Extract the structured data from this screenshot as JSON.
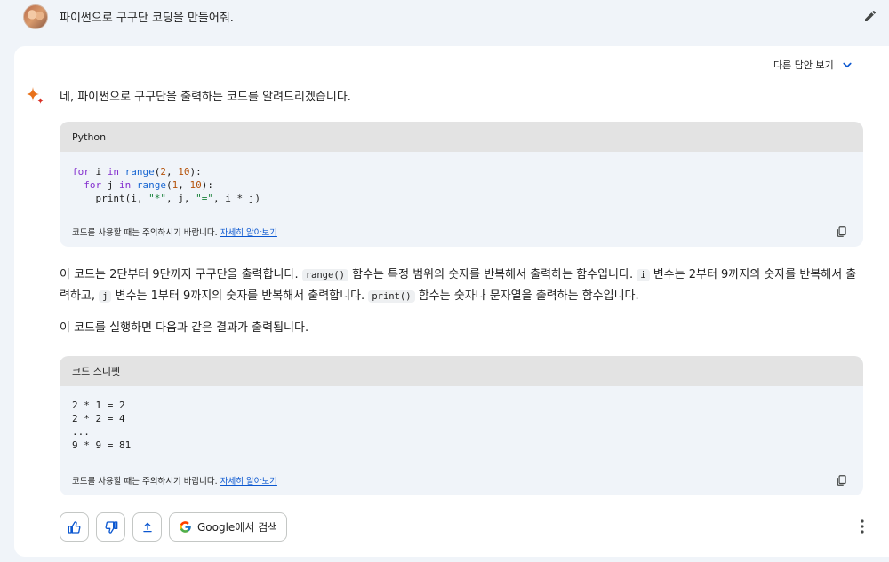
{
  "prompt": {
    "text": "파이썬으로 구구단 코딩을 만들어줘."
  },
  "answer": {
    "other_drafts_label": "다른 답안 보기",
    "intro": "네, 파이썬으로 구구단을 출력하는 코드를 알려드리겠습니다.",
    "code1": {
      "language": "Python",
      "lines": [
        [
          "for",
          " i ",
          "in",
          " ",
          "range",
          "(",
          "2",
          ", ",
          "10",
          "):"
        ],
        [
          "  for",
          " j ",
          "in",
          " ",
          "range",
          "(",
          "1",
          ", ",
          "10",
          "):"
        ]
      ],
      "line3_prefix": "    print(i, ",
      "line3_str1": "\"*\"",
      "line3_mid": ", j, ",
      "line3_str2": "\"=\"",
      "line3_end": ", i * j)"
    },
    "code_footer": "코드를 사용할 때는 주의하시기 바랍니다.",
    "learn_more": "자세히 알아보기",
    "para1": {
      "a": "이 코드는 2단부터 9단까지 구구단을 출력합니다.",
      "code_range": "range()",
      "b": "함수는 특정 범위의 숫자를 반복해서 출력하는 함수입니다.",
      "code_i": "i",
      "c": "변수는 2부터 9까지의 숫자를 반복해서 출력하고,",
      "code_j": "j",
      "d": "변수는 1부터 9까지의 숫자를 반복해서 출력합니다.",
      "code_print": "print()",
      "e": "함수는 숫자나 문자열을 출력하는 함수입니다."
    },
    "para2": "이 코드를 실행하면 다음과 같은 결과가 출력됩니다.",
    "code2": {
      "title": "코드 스니펫",
      "output": "2 * 1 = 2\n2 * 2 = 4\n...\n9 * 9 = 81"
    },
    "google_search_label": "Google에서 검색"
  },
  "icons": {
    "edit": "pencil-icon",
    "chevron": "chevron-down-icon",
    "spark": "gemini-spark-icon",
    "copy": "copy-icon",
    "like": "thumbs-up-icon",
    "dislike": "thumbs-down-icon",
    "share": "share-icon",
    "google": "google-g-icon",
    "more": "more-vert-icon"
  },
  "colors": {
    "accent": "#0b57d0",
    "background": "#f0f4f9",
    "code_keyword": "#8430ce",
    "code_function": "#1967d2",
    "code_number": "#b5530b",
    "code_string": "#188038"
  }
}
